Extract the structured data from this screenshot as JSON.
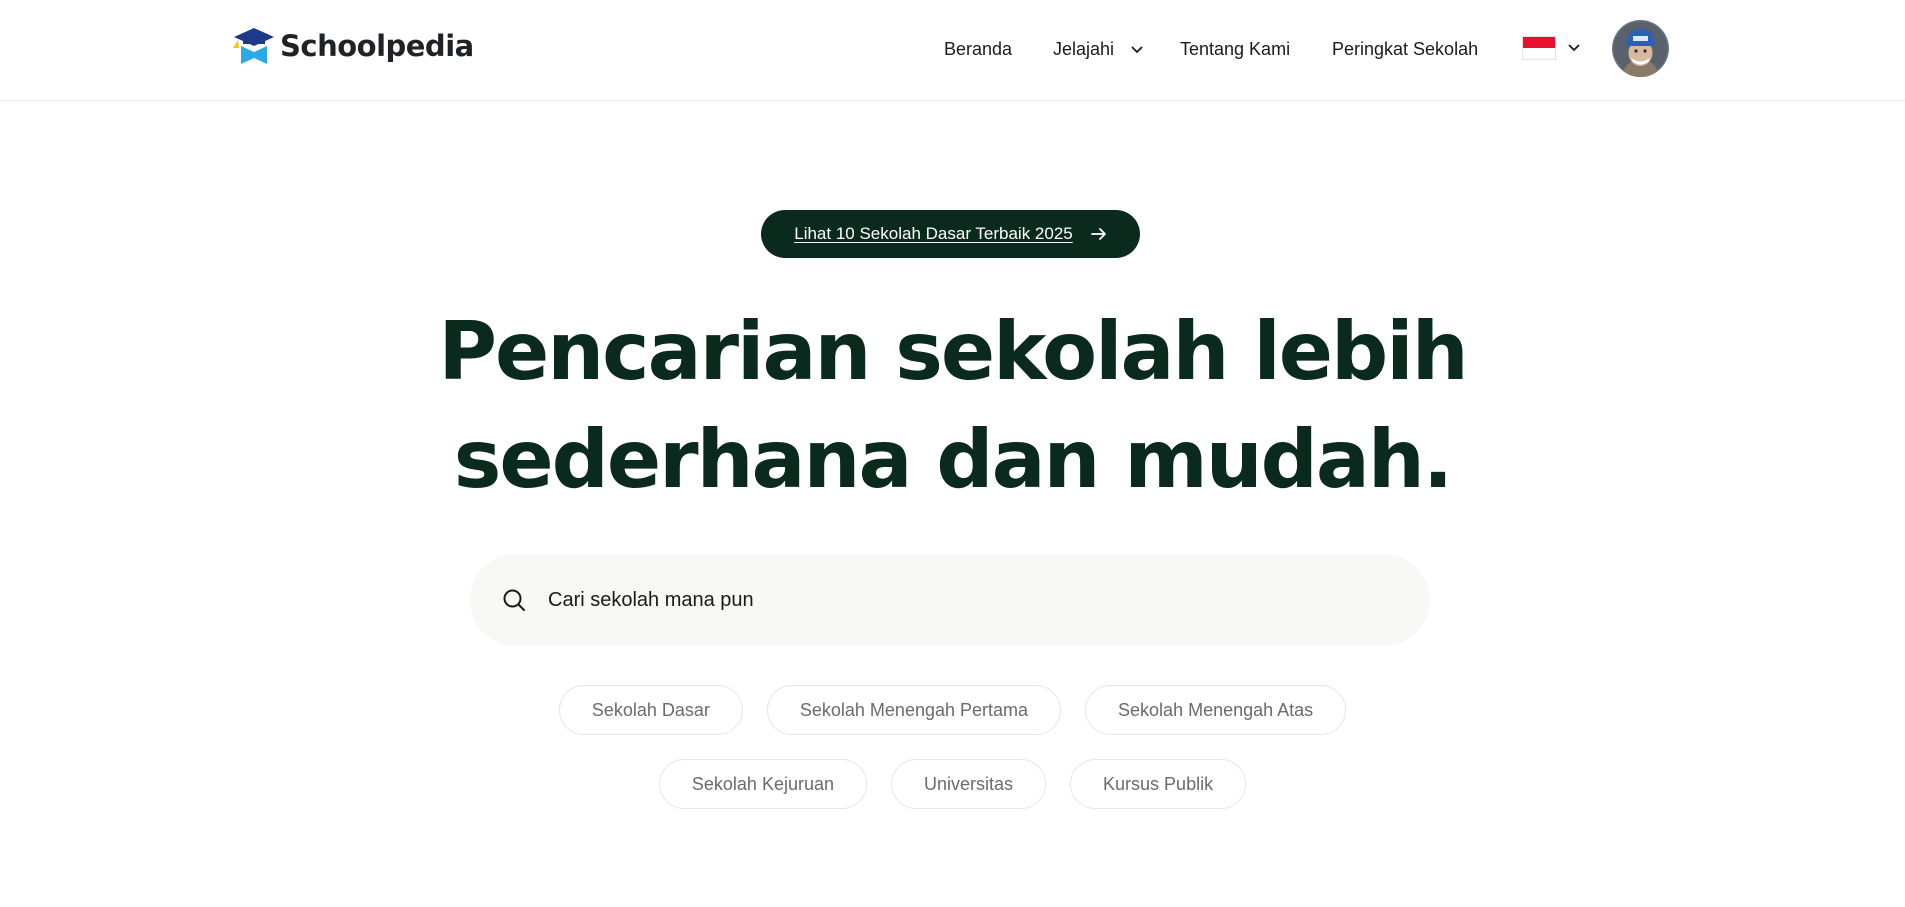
{
  "header": {
    "logo_text": "Schoolpedia",
    "nav": [
      {
        "label": "Beranda"
      },
      {
        "label": "Jelajahi",
        "icon": "chevron-down-icon"
      },
      {
        "label": "Tentang Kami"
      },
      {
        "label": "Peringkat Sekolah"
      }
    ],
    "language": {
      "flag": "indonesia-flag",
      "icon": "chevron-down-icon"
    },
    "avatar": "user-avatar"
  },
  "hero": {
    "promo_label": "Lihat 10 Sekolah Dasar Terbaik 2025",
    "promo_icon": "arrow-right-icon",
    "headline_line1": "Pencarian sekolah lebih",
    "headline_line2": "sederhana dan mudah."
  },
  "search": {
    "icon": "search-icon",
    "placeholder": "Cari sekolah mana pun"
  },
  "categories": [
    [
      "Sekolah Dasar",
      "Sekolah Menengah Pertama",
      "Sekolah Menengah Atas"
    ],
    [
      "Sekolah Kejuruan",
      "Universitas",
      "Kursus Publik"
    ]
  ],
  "colors": {
    "primary": "#0b2a1e",
    "logo_blue": "#2ea8e6",
    "logo_navy": "#1d3a8a",
    "logo_yellow": "#f5c518",
    "flag_red": "#e8112d"
  }
}
